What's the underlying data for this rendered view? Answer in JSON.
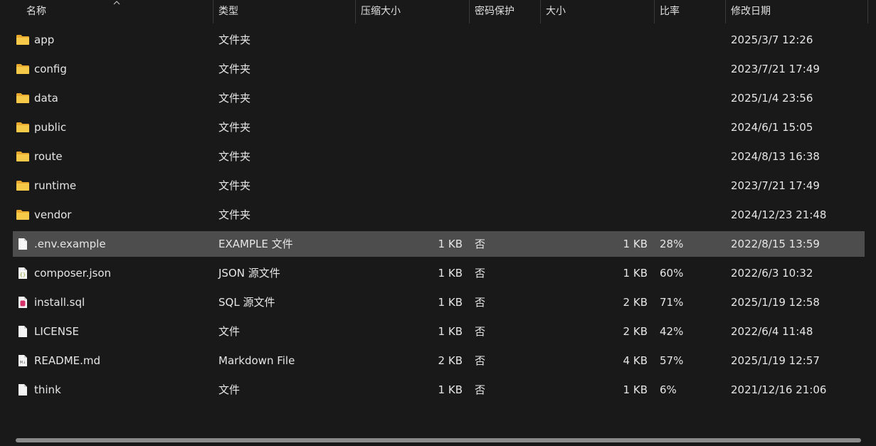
{
  "columns": {
    "name": "名称",
    "type": "类型",
    "compressed_size": "压缩大小",
    "password": "密码保护",
    "size": "大小",
    "ratio": "比率",
    "modified": "修改日期"
  },
  "rows": [
    {
      "name": "app",
      "icon": "folder-icon",
      "type": "文件夹",
      "compressed_size": "",
      "password": "",
      "size": "",
      "ratio": "",
      "modified": "2025/3/7 12:26"
    },
    {
      "name": "config",
      "icon": "folder-icon",
      "type": "文件夹",
      "compressed_size": "",
      "password": "",
      "size": "",
      "ratio": "",
      "modified": "2023/7/21 17:49"
    },
    {
      "name": "data",
      "icon": "folder-icon",
      "type": "文件夹",
      "compressed_size": "",
      "password": "",
      "size": "",
      "ratio": "",
      "modified": "2025/1/4 23:56"
    },
    {
      "name": "public",
      "icon": "folder-icon",
      "type": "文件夹",
      "compressed_size": "",
      "password": "",
      "size": "",
      "ratio": "",
      "modified": "2024/6/1 15:05"
    },
    {
      "name": "route",
      "icon": "folder-icon",
      "type": "文件夹",
      "compressed_size": "",
      "password": "",
      "size": "",
      "ratio": "",
      "modified": "2024/8/13 16:38"
    },
    {
      "name": "runtime",
      "icon": "folder-icon",
      "type": "文件夹",
      "compressed_size": "",
      "password": "",
      "size": "",
      "ratio": "",
      "modified": "2023/7/21 17:49"
    },
    {
      "name": "vendor",
      "icon": "folder-icon",
      "type": "文件夹",
      "compressed_size": "",
      "password": "",
      "size": "",
      "ratio": "",
      "modified": "2024/12/23 21:48"
    },
    {
      "name": ".env.example",
      "icon": "file-icon",
      "type": "EXAMPLE 文件",
      "compressed_size": "1 KB",
      "password": "否",
      "size": "1 KB",
      "ratio": "28%",
      "modified": "2022/8/15 13:59",
      "selected": true
    },
    {
      "name": "composer.json",
      "icon": "json-file-icon",
      "type": "JSON 源文件",
      "compressed_size": "1 KB",
      "password": "否",
      "size": "1 KB",
      "ratio": "60%",
      "modified": "2022/6/3 10:32"
    },
    {
      "name": "install.sql",
      "icon": "sql-file-icon",
      "type": "SQL 源文件",
      "compressed_size": "1 KB",
      "password": "否",
      "size": "2 KB",
      "ratio": "71%",
      "modified": "2025/1/19 12:58"
    },
    {
      "name": "LICENSE",
      "icon": "file-icon",
      "type": "文件",
      "compressed_size": "1 KB",
      "password": "否",
      "size": "2 KB",
      "ratio": "42%",
      "modified": "2022/6/4 11:48"
    },
    {
      "name": "README.md",
      "icon": "markdown-file-icon",
      "type": "Markdown File",
      "compressed_size": "2 KB",
      "password": "否",
      "size": "4 KB",
      "ratio": "57%",
      "modified": "2025/1/19 12:57"
    },
    {
      "name": "think",
      "icon": "file-icon",
      "type": "文件",
      "compressed_size": "1 KB",
      "password": "否",
      "size": "1 KB",
      "ratio": "6%",
      "modified": "2021/12/16 21:06"
    }
  ],
  "colors": {
    "background": "#191919",
    "selected_row": "#4d4d4d",
    "folder": "#f3c04a",
    "text": "#e6e6e6"
  }
}
